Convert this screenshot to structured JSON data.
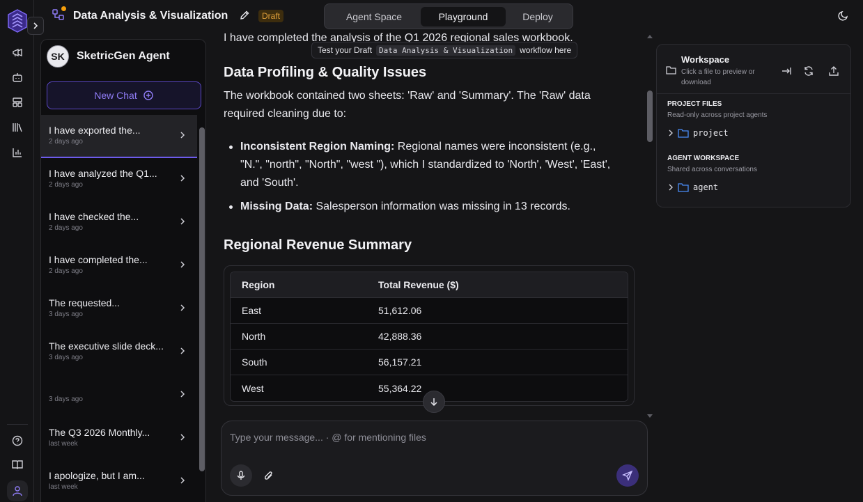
{
  "app": {
    "workflow_title": "Data Analysis & Visualization",
    "status_badge": "Draft",
    "accent_color": "#6d5bea"
  },
  "mode_tabs": [
    {
      "label": "Agent Space",
      "active": false
    },
    {
      "label": "Playground",
      "active": true
    },
    {
      "label": "Deploy",
      "active": false
    }
  ],
  "rail_icons": [
    "megaphone-icon",
    "bot-icon",
    "layout-icon",
    "library-icon",
    "chart-icon",
    "help-icon",
    "book-icon",
    "user-icon"
  ],
  "agent": {
    "initials": "SK",
    "name": "SketricGen Agent",
    "new_chat_label": "New Chat"
  },
  "chats": [
    {
      "title": "I have exported the...",
      "time": "2 days ago",
      "active": true
    },
    {
      "title": "I have analyzed the Q1...",
      "time": "2 days ago",
      "active": false
    },
    {
      "title": "I have checked the...",
      "time": "2 days ago",
      "active": false
    },
    {
      "title": "I have completed the...",
      "time": "2 days ago",
      "active": false
    },
    {
      "title": "The requested...",
      "time": "3 days ago",
      "active": false
    },
    {
      "title": "The executive slide deck...",
      "time": "3 days ago",
      "active": false
    },
    {
      "title": "",
      "time": "3 days ago",
      "active": false
    },
    {
      "title": "The Q3 2026 Monthly...",
      "time": "last week",
      "active": false
    },
    {
      "title": "I apologize, but I am...",
      "time": "last week",
      "active": false
    }
  ],
  "tooltip": {
    "prefix": "Test your Draft",
    "code": "Data Analysis & Visualization",
    "suffix": "workflow here"
  },
  "message": {
    "intro": "I have completed the analysis of the Q1 2026 regional sales workbook.",
    "h_profiling": "Data Profiling & Quality Issues",
    "profiling_text": "The workbook contained two sheets: 'Raw' and 'Summary'. The 'Raw' data required cleaning due to:",
    "bullets": [
      {
        "bold": "Inconsistent Region Naming:",
        "text": " Regional names were inconsistent (e.g., \"N.\", \"north\", \"North\", \"west \"), which I standardized to 'North', 'West', 'East', and 'South'."
      },
      {
        "bold": "Missing Data:",
        "text": " Salesperson information was missing in 13 records."
      }
    ],
    "h_summary": "Regional Revenue Summary",
    "table": {
      "headers": [
        "Region",
        "Total Revenue ($)"
      ],
      "rows": [
        [
          "East",
          "51,612.06"
        ],
        [
          "North",
          "42,888.36"
        ],
        [
          "South",
          "56,157.21"
        ],
        [
          "West",
          "55,364.22"
        ]
      ]
    }
  },
  "composer": {
    "placeholder": "Type your message... · @ for mentioning files"
  },
  "workspace": {
    "title": "Workspace",
    "subtitle": "Click a file to preview or download",
    "project_files_label": "PROJECT FILES",
    "project_files_sub": "Read-only across project agents",
    "project_folder": "project",
    "agent_workspace_label": "AGENT WORKSPACE",
    "agent_workspace_sub": "Shared across conversations",
    "agent_folder": "agent"
  }
}
